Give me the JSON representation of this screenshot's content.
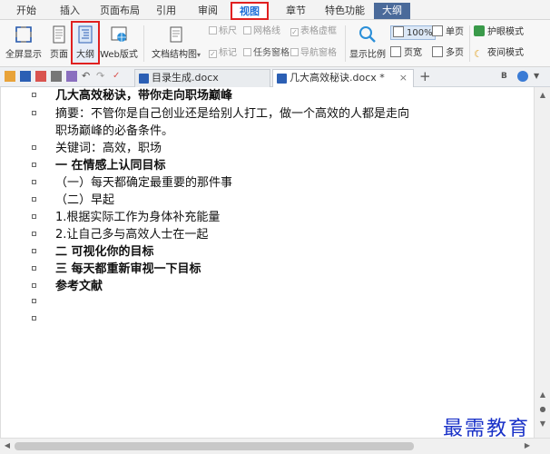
{
  "menu": {
    "tabs": [
      "开始",
      "插入",
      "页面布局",
      "引用",
      "审阅",
      "视图",
      "章节",
      "特色功能",
      "大纲"
    ],
    "active": "视图"
  },
  "ribbon": {
    "fullscreen": "全屏显示",
    "page": "页面",
    "outline": "大纲",
    "web": "Web版式",
    "docmap": "文档结构图",
    "ruler": "标尺",
    "gridlines": "网格线",
    "table_border": "表格虚框",
    "mark": "标记",
    "taskpane": "任务窗格",
    "navpane": "导航窗格",
    "zoom": "显示比例",
    "zoom_value": "100%",
    "page_width": "页宽",
    "single_page": "单页",
    "multi_page": "多页",
    "eye_protect": "护眼模式",
    "night_mode": "夜间模式"
  },
  "doc_tabs": [
    {
      "title": "目录生成.docx",
      "active": false
    },
    {
      "title": "几大高效秘诀.docx *",
      "active": true
    }
  ],
  "document": {
    "lines": [
      {
        "text": "几大高效秘诀，带你走向职场巅峰",
        "bold": true
      },
      {
        "text": "摘要：不管你是自己创业还是给别人打工，做一个高效的人都是走向",
        "bold": false
      },
      {
        "text": "职场巅峰的必备条件。",
        "bold": false
      },
      {
        "text": "关键词：高效，职场",
        "bold": false
      },
      {
        "text": "一 在情感上认同目标",
        "bold": true
      },
      {
        "text": "（一）每天都确定最重要的那件事",
        "bold": false
      },
      {
        "text": "（二）早起",
        "bold": false
      },
      {
        "text": "1.根据实际工作为身体补充能量",
        "bold": false
      },
      {
        "text": "2.让自己多与高效人士在一起",
        "bold": false
      },
      {
        "text": "二 可视化你的目标",
        "bold": true
      },
      {
        "text": "三 每天都重新审视一下目标",
        "bold": true
      },
      {
        "text": "参考文献",
        "bold": true
      }
    ]
  },
  "watermark": "最需教育",
  "colors": {
    "accent": "#1f6fd8",
    "highlight": "#e02020",
    "watermark": "#1a32c8"
  }
}
